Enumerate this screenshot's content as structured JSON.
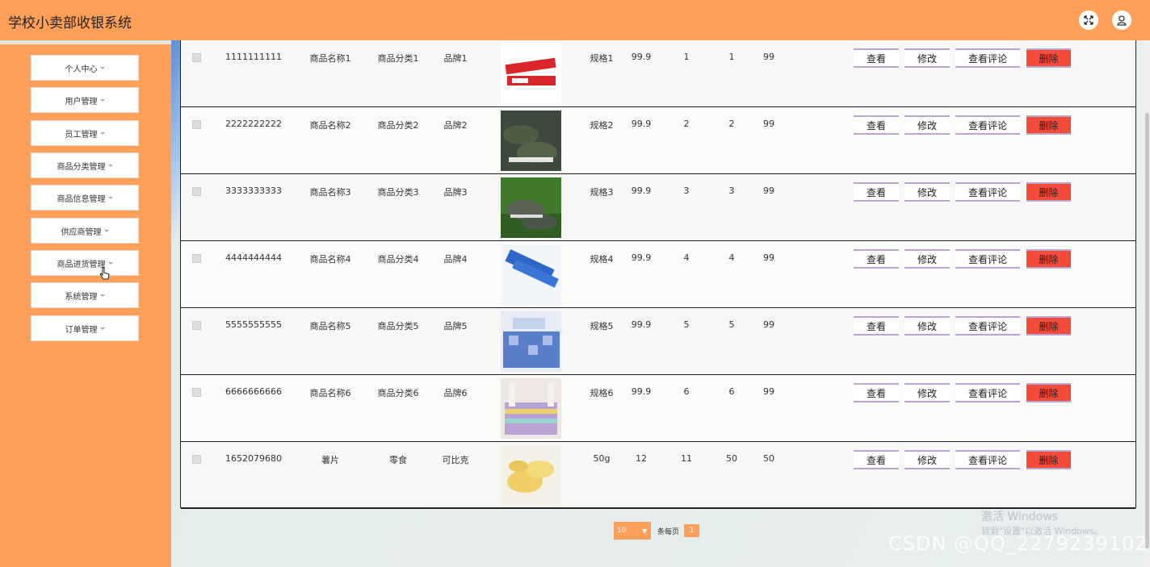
{
  "app": {
    "title": "学校小卖部收银系统"
  },
  "header": {
    "fullscreen_icon": "expand-icon",
    "user_icon": "user-icon"
  },
  "sidebar": {
    "items": [
      {
        "label": "个人中心"
      },
      {
        "label": "用户管理"
      },
      {
        "label": "员工管理"
      },
      {
        "label": "商品分类管理"
      },
      {
        "label": "商品信息管理"
      },
      {
        "label": "供应商管理"
      },
      {
        "label": "商品进货管理"
      },
      {
        "label": "系统管理"
      },
      {
        "label": "订单管理"
      }
    ]
  },
  "table": {
    "rows": [
      {
        "code": "1111111111",
        "name": "商品名称1",
        "category": "商品分类1",
        "brand": "品牌1",
        "image": "toothpaste",
        "spec": "规格1",
        "price": "99.9",
        "c1": "1",
        "c2": "1",
        "c3": "99"
      },
      {
        "code": "2222222222",
        "name": "商品名称2",
        "category": "商品分类2",
        "brand": "品牌2",
        "image": "camo-shoes",
        "spec": "规格2",
        "price": "99.9",
        "c1": "2",
        "c2": "2",
        "c3": "99"
      },
      {
        "code": "3333333333",
        "name": "商品名称3",
        "category": "商品分类3",
        "brand": "品牌3",
        "image": "camo-shoes-grass",
        "spec": "规格3",
        "price": "99.9",
        "c1": "3",
        "c2": "3",
        "c3": "99"
      },
      {
        "code": "4444444444",
        "name": "商品名称4",
        "category": "商品分类4",
        "brand": "品牌4",
        "image": "toothpaste-blue",
        "spec": "规格4",
        "price": "99.9",
        "c1": "4",
        "c2": "4",
        "c3": "99"
      },
      {
        "code": "5555555555",
        "name": "商品名称5",
        "category": "商品分类5",
        "brand": "品牌5",
        "image": "bedding-blue",
        "spec": "规格5",
        "price": "99.9",
        "c1": "5",
        "c2": "5",
        "c3": "99"
      },
      {
        "code": "6666666666",
        "name": "商品名称6",
        "category": "商品分类6",
        "brand": "品牌6",
        "image": "bedding-pastel",
        "spec": "规格6",
        "price": "99.9",
        "c1": "6",
        "c2": "6",
        "c3": "99"
      },
      {
        "code": "1652079680",
        "name": "薯片",
        "category": "零食",
        "brand": "可比克",
        "image": "chips",
        "spec": "50g",
        "price": "12",
        "c1": "11",
        "c2": "50",
        "c3": "50"
      }
    ],
    "actions": {
      "view": "查看",
      "edit": "修改",
      "reviews": "查看评论",
      "delete": "删除"
    }
  },
  "pagination": {
    "page_size": "10",
    "per_page_label": "条每页",
    "current_page": "1"
  },
  "overlay": {
    "watermark": "CSDN @QQ_2279239102",
    "activate_line1": "激活 Windows",
    "activate_line2": "转到\"设置\"以激活 Windows。"
  },
  "colors": {
    "accent": "#ffa05a",
    "delete": "#f54b3a",
    "button_border": "#b9a5cf"
  }
}
